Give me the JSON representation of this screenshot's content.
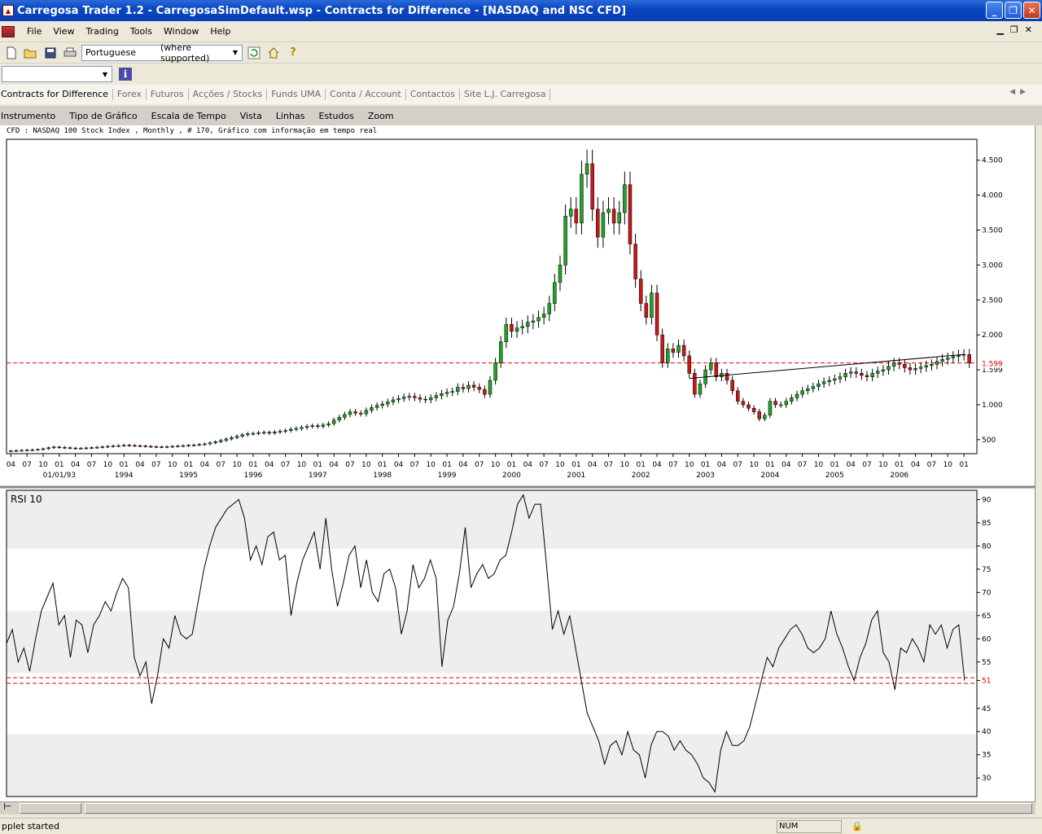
{
  "window": {
    "title": "Carregosa Trader 1.2 - CarregosaSimDefault.wsp - Contracts for Difference - [NASDAQ and NSC CFD]",
    "buttons": [
      "_",
      "❐",
      "✕"
    ]
  },
  "menu": [
    "File",
    "View",
    "Trading",
    "Tools",
    "Window",
    "Help"
  ],
  "toolbar": {
    "language_value": "Portuguese",
    "language_note": "(where supported)",
    "icons": [
      "new-icon",
      "open-icon",
      "save-icon",
      "print-icon",
      "refresh-icon",
      "home-icon",
      "help-icon"
    ]
  },
  "toolbar2": {
    "combo_value": "",
    "info_label": "i"
  },
  "tabs": [
    "Contracts for Difference",
    "Forex",
    "Futuros",
    "Acções / Stocks",
    "Funds UMA",
    "Conta / Account",
    "Contactos",
    "Site L.J. Carregosa"
  ],
  "chart_menu": [
    "Instrumento",
    "Tipo de Gráfico",
    "Escala de Tempo",
    "Vista",
    "Linhas",
    "Estudos",
    "Zoom"
  ],
  "chart_header": "CFD : NASDAQ 100 Stock Index , Monthly , # 170, Gráfico com informação em tempo real",
  "colors": {
    "up": "#22a22a",
    "down": "#c8171a",
    "ref_line": "#e00000",
    "rsi_band": "#eeeeee"
  },
  "chart_data": [
    {
      "type": "candlestick",
      "title": "",
      "ylim": [
        300,
        4800
      ],
      "y_ticks": [
        500,
        1000,
        1500,
        2000,
        2500,
        3000,
        3500,
        4000,
        4500
      ],
      "y_tick_labels": [
        "500",
        "1.000",
        "1.599",
        "2.000",
        "2.500",
        "3.000",
        "3.500",
        "4.000",
        "4.500"
      ],
      "reference_line": {
        "value": 1599,
        "label": "1.599"
      },
      "start_month": "1992-04",
      "x_month_labels": [
        "04",
        "07",
        "10",
        "01",
        "04",
        "07",
        "10",
        "01",
        "04",
        "07",
        "10",
        "01",
        "04",
        "07",
        "10",
        "01",
        "04",
        "07",
        "10",
        "01",
        "04",
        "07",
        "10",
        "01",
        "04",
        "07",
        "10",
        "01",
        "04",
        "07",
        "10",
        "01",
        "04",
        "07",
        "10",
        "01",
        "04",
        "07",
        "10",
        "01",
        "04",
        "07",
        "10",
        "01",
        "04",
        "07",
        "10",
        "01",
        "04",
        "07",
        "10",
        "01",
        "04",
        "07",
        "10",
        "01",
        "04",
        "07",
        "10",
        "01"
      ],
      "x_year_labels": [
        "01/01/93",
        "1994",
        "1995",
        "1996",
        "1997",
        "1998",
        "1999",
        "2000",
        "2001",
        "2002",
        "2003",
        "2004",
        "2005",
        "2006"
      ],
      "close": [
        340,
        345,
        348,
        352,
        356,
        360,
        370,
        385,
        395,
        390,
        385,
        380,
        375,
        378,
        382,
        386,
        392,
        398,
        405,
        410,
        415,
        420,
        418,
        414,
        410,
        405,
        400,
        398,
        395,
        400,
        405,
        410,
        415,
        420,
        425,
        432,
        440,
        455,
        470,
        490,
        510,
        530,
        550,
        570,
        585,
        590,
        600,
        605,
        595,
        610,
        620,
        630,
        650,
        660,
        675,
        690,
        700,
        690,
        710,
        730,
        780,
        820,
        860,
        900,
        880,
        870,
        920,
        960,
        990,
        1010,
        1040,
        1070,
        1090,
        1110,
        1120,
        1100,
        1080,
        1070,
        1100,
        1130,
        1160,
        1180,
        1190,
        1250,
        1230,
        1280,
        1250,
        1220,
        1150,
        1350,
        1600,
        1900,
        2150,
        2050,
        2100,
        2120,
        2180,
        2200,
        2250,
        2300,
        2450,
        2750,
        3000,
        3700,
        3800,
        3600,
        4300,
        4450,
        3800,
        3400,
        3750,
        3800,
        3600,
        3750,
        4150,
        3300,
        2800,
        2450,
        2250,
        2600,
        2000,
        1600,
        1800,
        1750,
        1850,
        1700,
        1450,
        1150,
        1300,
        1500,
        1600,
        1400,
        1450,
        1350,
        1200,
        1050,
        1000,
        950,
        900,
        800,
        850,
        1050,
        1000,
        1000,
        1050,
        1100,
        1150,
        1200,
        1230,
        1260,
        1300,
        1330,
        1350,
        1370,
        1400,
        1450,
        1470,
        1450,
        1420,
        1400,
        1450,
        1480,
        1500,
        1550,
        1600,
        1580,
        1530,
        1500,
        1520,
        1540,
        1560,
        1580,
        1620,
        1650,
        1670,
        1690,
        1710,
        1720,
        1599
      ]
    },
    {
      "type": "line",
      "title": "RSI 10",
      "ylim": [
        26,
        92
      ],
      "y_ticks": [
        30,
        35,
        40,
        45,
        51,
        55,
        60,
        65,
        70,
        75,
        80,
        85,
        90
      ],
      "y_tick_labels": [
        "30",
        "35",
        "40",
        "45",
        "51",
        "55",
        "60",
        "65",
        "70",
        "75",
        "80",
        "85",
        "90"
      ],
      "bands": [
        [
          26,
          39.4
        ],
        [
          52.6,
          66
        ],
        [
          79.4,
          92
        ]
      ],
      "reference_lines": [
        50.4,
        51.6
      ],
      "values": [
        59,
        62,
        55,
        58,
        53,
        60,
        66,
        69,
        72,
        63,
        65,
        56,
        64,
        63,
        57,
        63,
        65,
        68,
        66,
        70,
        73,
        71,
        56,
        52,
        55,
        46,
        52,
        60,
        58,
        65,
        61,
        60,
        61,
        68,
        75,
        80,
        84,
        86,
        88,
        89,
        90,
        86,
        77,
        80,
        76,
        82,
        83,
        77,
        78,
        65,
        72,
        77,
        80,
        83,
        75,
        86,
        75,
        67,
        72,
        78,
        80,
        71,
        77,
        70,
        68,
        74,
        75,
        71,
        61,
        66,
        76,
        71,
        73,
        77,
        73,
        54,
        64,
        67,
        74,
        84,
        71,
        74,
        76,
        73,
        74,
        77,
        78,
        83,
        89,
        91,
        86,
        89,
        89,
        76,
        62,
        66,
        61,
        65,
        58,
        51,
        44,
        41,
        38,
        33,
        37,
        38,
        35,
        40,
        36,
        35,
        30,
        37,
        40,
        40,
        39,
        36,
        38,
        36,
        35,
        33,
        30,
        29,
        27,
        36,
        40,
        37,
        37,
        38,
        41,
        46,
        51,
        56,
        54,
        58,
        60,
        62,
        63,
        61,
        58,
        57,
        58,
        60,
        66,
        61,
        58,
        54,
        51,
        56,
        59,
        64,
        66,
        57,
        55,
        49,
        58,
        57,
        60,
        58,
        55,
        63,
        61,
        63,
        58,
        62,
        63,
        51
      ]
    }
  ],
  "status": {
    "message": "pplet started",
    "num": "NUM"
  }
}
